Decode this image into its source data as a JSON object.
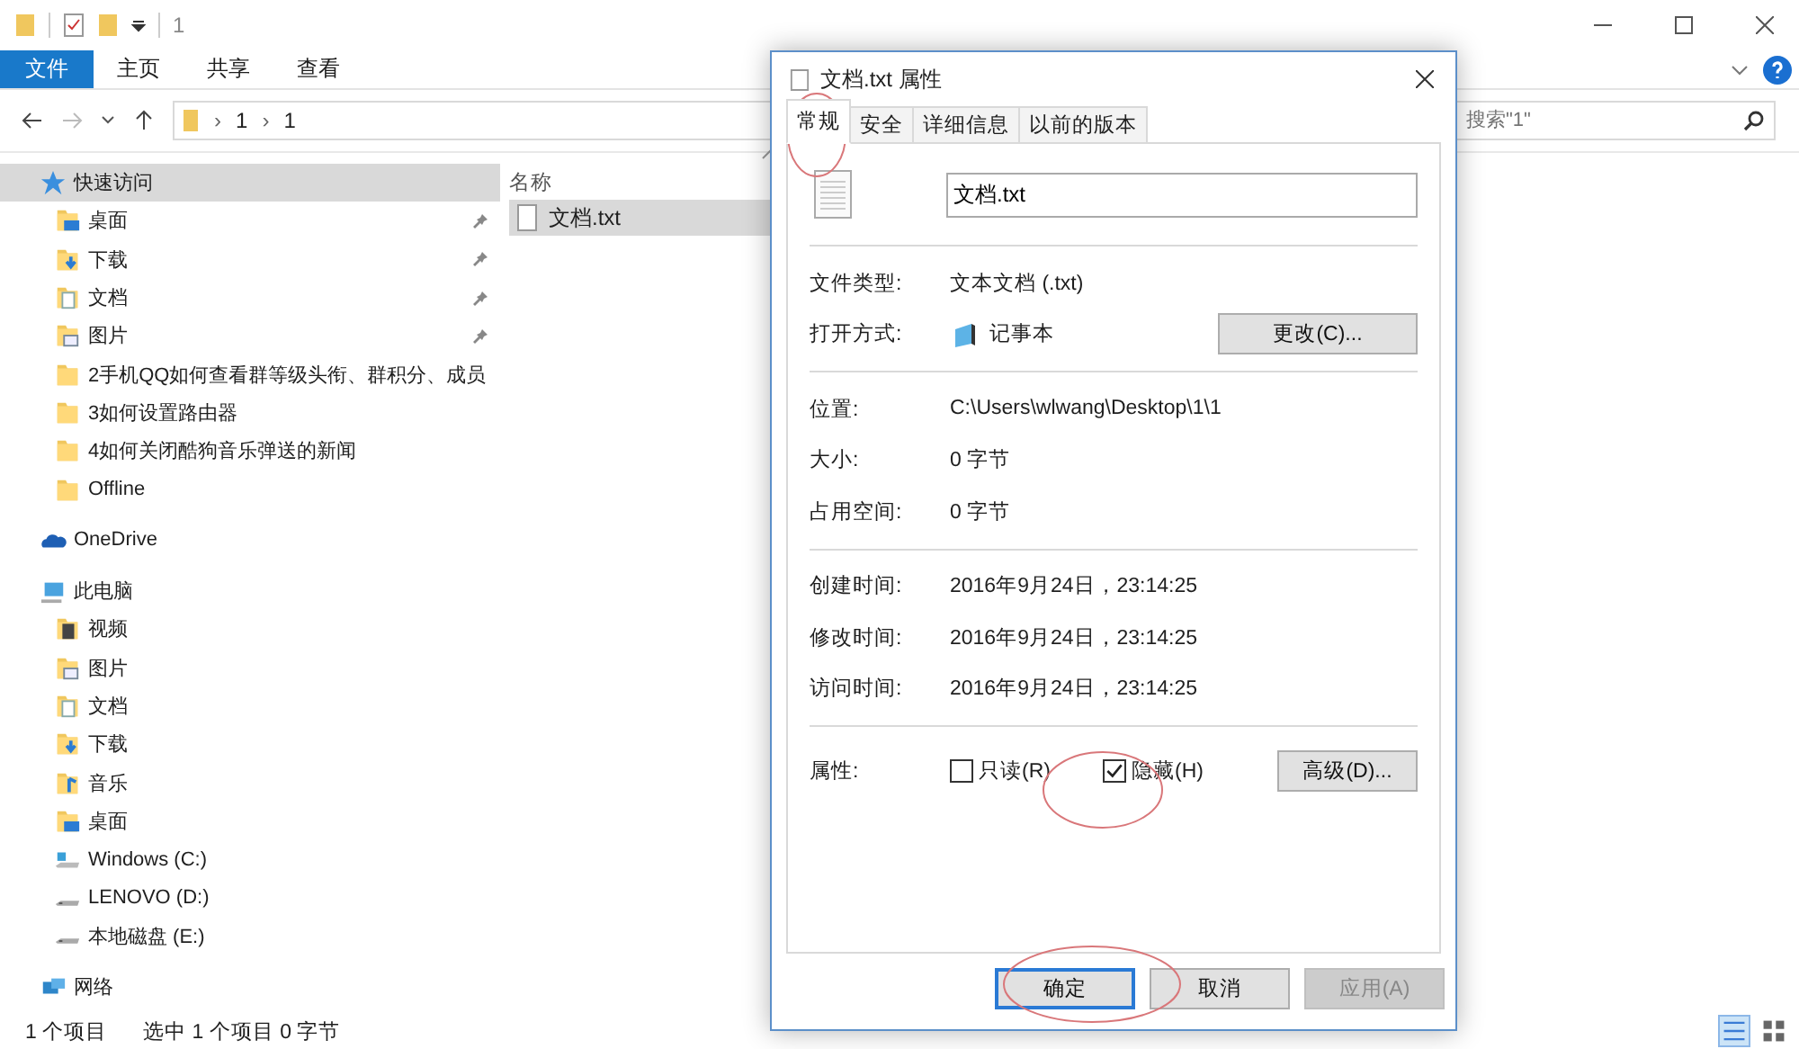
{
  "window": {
    "title": "1"
  },
  "ribbon_tabs": [
    {
      "label": "文件",
      "selected": true
    },
    {
      "label": "主页",
      "selected": false
    },
    {
      "label": "共享",
      "selected": false
    },
    {
      "label": "查看",
      "selected": false
    }
  ],
  "address": {
    "separator": "›",
    "path": [
      "1",
      "1"
    ]
  },
  "search": {
    "placeholder": "搜索\"1\""
  },
  "nav": [
    {
      "label": "快速访问",
      "kind": "quick",
      "selected": true,
      "children": [
        {
          "label": "桌面",
          "kind": "desktop",
          "pinned": true
        },
        {
          "label": "下载",
          "kind": "downloads",
          "pinned": true
        },
        {
          "label": "文档",
          "kind": "documents",
          "pinned": true
        },
        {
          "label": "图片",
          "kind": "pictures",
          "pinned": true
        },
        {
          "label": "2手机QQ如何查看群等级头衔、群积分、成员",
          "kind": "folder",
          "pinned": false
        },
        {
          "label": "3如何设置路由器",
          "kind": "folder",
          "pinned": false
        },
        {
          "label": "4如何关闭酷狗音乐弹送的新闻",
          "kind": "folder",
          "pinned": false
        },
        {
          "label": "Offline",
          "kind": "folder",
          "pinned": false
        }
      ]
    },
    {
      "label": "OneDrive",
      "kind": "onedrive",
      "selected": false
    },
    {
      "label": "此电脑",
      "kind": "pc",
      "selected": false,
      "children": [
        {
          "label": "视频",
          "kind": "videos",
          "pinned": false
        },
        {
          "label": "图片",
          "kind": "pictures",
          "pinned": false
        },
        {
          "label": "文档",
          "kind": "documents",
          "pinned": false
        },
        {
          "label": "下载",
          "kind": "downloads",
          "pinned": false
        },
        {
          "label": "音乐",
          "kind": "music",
          "pinned": false
        },
        {
          "label": "桌面",
          "kind": "desktop",
          "pinned": false
        },
        {
          "label": "Windows (C:)",
          "kind": "system_drive",
          "pinned": false
        },
        {
          "label": "LENOVO (D:)",
          "kind": "drive",
          "pinned": false
        },
        {
          "label": "本地磁盘 (E:)",
          "kind": "drive",
          "pinned": false
        }
      ]
    },
    {
      "label": "网络",
      "kind": "network",
      "selected": false
    }
  ],
  "files": {
    "column": "名称",
    "rows": [
      {
        "name": "文档.txt",
        "selected": true
      }
    ]
  },
  "status_bar": [
    "1 个项目",
    "选中 1 个项目  0 字节"
  ],
  "dialog": {
    "title": "文档.txt 属性",
    "tabs": [
      {
        "label": "常规",
        "selected": true
      },
      {
        "label": "安全",
        "selected": false
      },
      {
        "label": "详细信息",
        "selected": false
      },
      {
        "label": "以前的版本",
        "selected": false
      }
    ],
    "file_name": "文档.txt",
    "groups": [
      [
        {
          "label": "文件类型:",
          "value": "文本文档 (.txt)",
          "kind": "text"
        },
        {
          "label": "打开方式:",
          "value": "记事本",
          "kind": "app",
          "button": "更改(C)..."
        }
      ],
      [
        {
          "label": "位置:",
          "value": "C:\\Users\\wlwang\\Desktop\\1\\1",
          "kind": "text"
        },
        {
          "label": "大小:",
          "value": "0 字节",
          "kind": "text"
        },
        {
          "label": "占用空间:",
          "value": "0 字节",
          "kind": "text"
        }
      ],
      [
        {
          "label": "创建时间:",
          "value": "2016年9月24日，23:14:25",
          "kind": "text"
        },
        {
          "label": "修改时间:",
          "value": "2016年9月24日，23:14:25",
          "kind": "text"
        },
        {
          "label": "访问时间:",
          "value": "2016年9月24日，23:14:25",
          "kind": "text"
        }
      ]
    ],
    "attributes": {
      "label": "属性:",
      "options": [
        {
          "label": "只读(R)",
          "checked": false
        },
        {
          "label": "隐藏(H)",
          "checked": true
        }
      ],
      "button": "高级(D)..."
    },
    "buttons": [
      {
        "label": "确定",
        "default": true,
        "disabled": false
      },
      {
        "label": "取消",
        "default": false,
        "disabled": false
      },
      {
        "label": "应用(A)",
        "default": false,
        "disabled": true
      }
    ]
  }
}
